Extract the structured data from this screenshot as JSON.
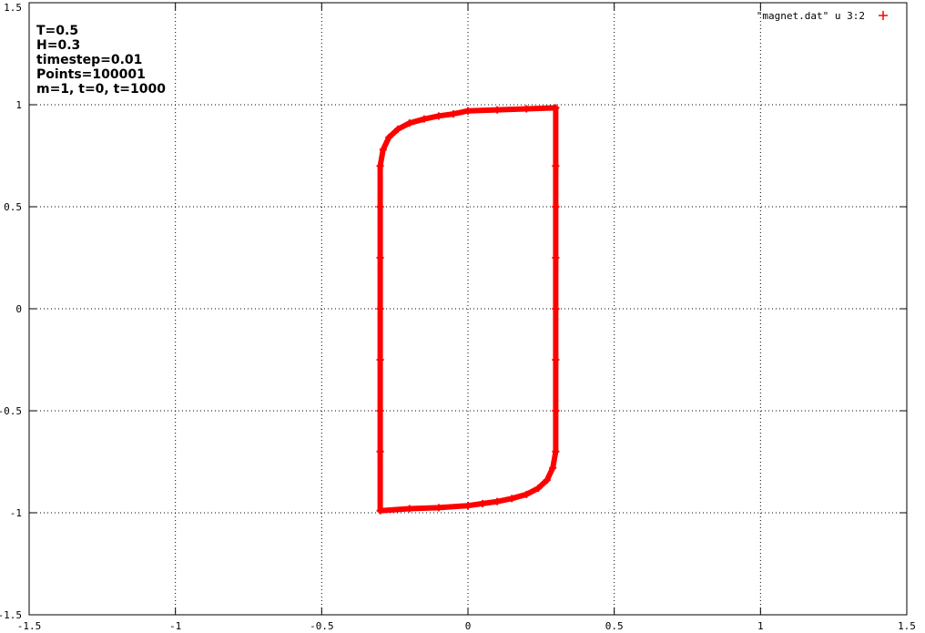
{
  "chart_data": {
    "type": "scatter",
    "title": "",
    "xlabel": "",
    "ylabel": "",
    "xlim": [
      -1.5,
      1.5
    ],
    "ylim": [
      -1.5,
      1.5
    ],
    "grid": true,
    "legend_position": "top-right",
    "x_ticks": [
      "-1.5",
      "-1",
      "-0.5",
      "0",
      "0.5",
      "1",
      "1.5"
    ],
    "y_ticks": [
      "1.5",
      "1",
      "0.5",
      "0",
      "-0.5",
      "-1",
      "-1.5"
    ],
    "annotations": [
      "T=0.5",
      "H=0.3",
      "timestep=0.01",
      "Points=100001",
      "m=1, t=0, t=1000"
    ],
    "series": [
      {
        "name": "\"magnet.dat\" u 3:2",
        "marker": "+",
        "color": "#ff0000",
        "x": [
          0.0,
          0.1,
          0.2,
          0.3,
          0.3,
          0.3,
          0.3,
          0.3,
          0.3,
          0.3,
          0.3,
          0.29,
          0.27,
          0.24,
          0.2,
          0.15,
          0.1,
          0.05,
          0.0,
          -0.1,
          -0.2,
          -0.3,
          -0.3,
          -0.3,
          -0.3,
          -0.3,
          -0.3,
          -0.3,
          -0.3,
          -0.29,
          -0.27,
          -0.24,
          -0.2,
          -0.15,
          -0.1,
          -0.05,
          0.0
        ],
        "y": [
          0.97,
          0.975,
          0.98,
          0.985,
          0.7,
          0.5,
          0.25,
          0.0,
          -0.25,
          -0.5,
          -0.7,
          -0.78,
          -0.84,
          -0.88,
          -0.91,
          -0.93,
          -0.945,
          -0.955,
          -0.965,
          -0.975,
          -0.98,
          -0.99,
          -0.7,
          -0.5,
          -0.25,
          0.0,
          0.25,
          0.5,
          0.7,
          0.78,
          0.84,
          0.88,
          0.91,
          0.93,
          0.945,
          0.955,
          0.97
        ]
      }
    ]
  }
}
